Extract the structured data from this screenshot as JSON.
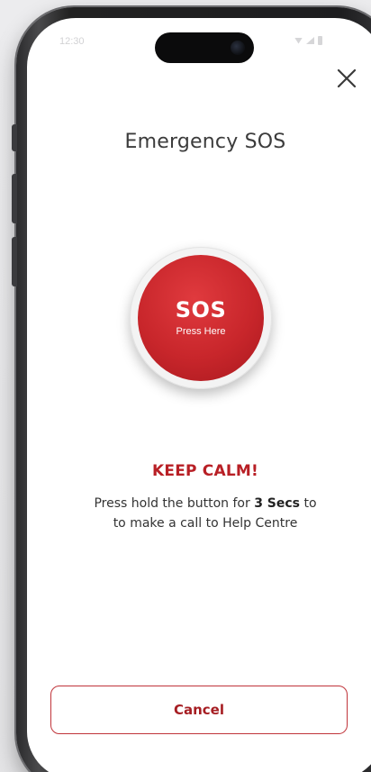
{
  "status_bar": {
    "time": "12:30",
    "icons": [
      "wifi-icon",
      "signal-icon",
      "battery-icon"
    ]
  },
  "header": {
    "close_icon": "close-icon",
    "title": "Emergency SOS"
  },
  "sos_button": {
    "label": "SOS",
    "sublabel": "Press Here",
    "color": "#c8262b"
  },
  "message": {
    "heading": "KEEP CALM!",
    "line_before": "Press hold the button for ",
    "emphasis": "3 Secs",
    "line_after": " to",
    "line2": "to make a call to Help Centre",
    "heading_color": "#b81f25"
  },
  "footer": {
    "cancel_label": "Cancel",
    "accent": "#c0343a"
  }
}
